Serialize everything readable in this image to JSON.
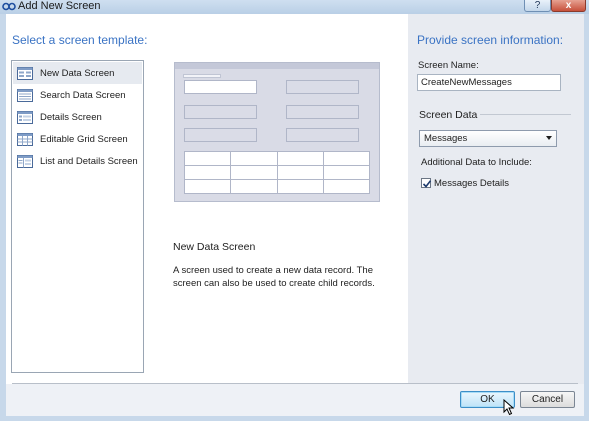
{
  "window": {
    "title": "Add New Screen",
    "help_glyph": "?",
    "close_glyph": "x"
  },
  "left_heading": "Select a screen template:",
  "templates": [
    {
      "label": "New Data Screen",
      "icon": "new-data-screen-icon"
    },
    {
      "label": "Search Data Screen",
      "icon": "search-data-screen-icon"
    },
    {
      "label": "Details Screen",
      "icon": "details-screen-icon"
    },
    {
      "label": "Editable Grid Screen",
      "icon": "editable-grid-screen-icon"
    },
    {
      "label": "List and Details Screen",
      "icon": "list-and-details-screen-icon"
    }
  ],
  "selected_template_index": 0,
  "preview": {
    "title": "New Data Screen",
    "description": "A screen used to create a new data record.  The screen can also be used to create child records."
  },
  "right_heading": "Provide screen information:",
  "screen_name": {
    "label": "Screen Name:",
    "value": "CreateNewMessages"
  },
  "screen_data": {
    "label": "Screen Data",
    "selected": "Messages"
  },
  "additional_data": {
    "label": "Additional Data to Include:",
    "checkbox_label": "Messages Details",
    "checked": true
  },
  "buttons": {
    "ok": "OK",
    "cancel": "Cancel"
  },
  "colors": {
    "heading": "#3a73c4",
    "right_panel": "#e8ebf1",
    "ok_border": "#3c8ec7"
  }
}
